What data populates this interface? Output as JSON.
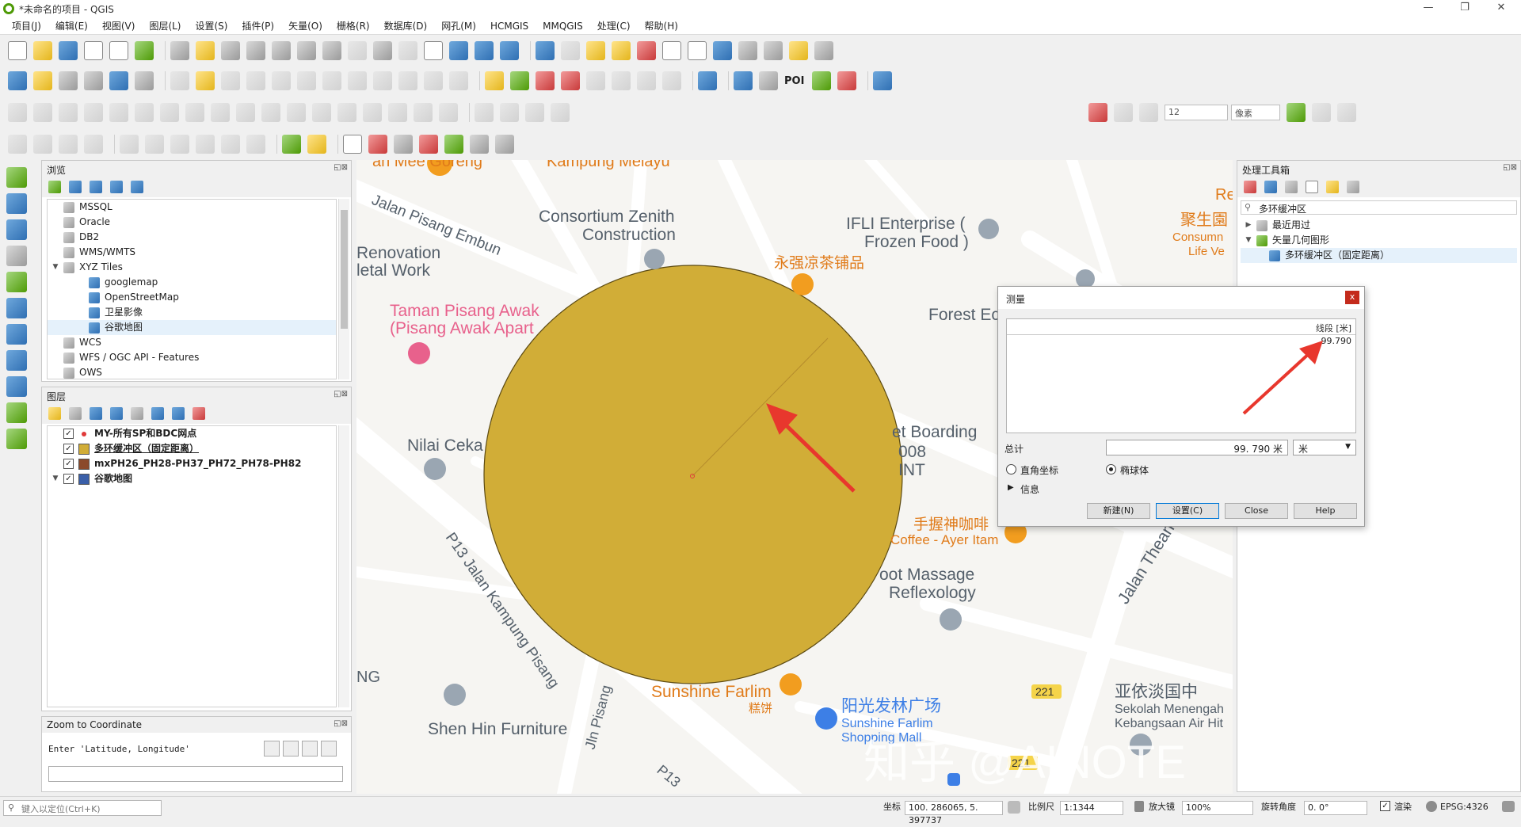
{
  "window": {
    "title": "*未命名的项目 - QGIS",
    "controls": [
      "—",
      "❐",
      "✕"
    ]
  },
  "menu": [
    "项目(J)",
    "编辑(E)",
    "视图(V)",
    "图层(L)",
    "设置(S)",
    "插件(P)",
    "矢量(O)",
    "栅格(R)",
    "数据库(D)",
    "网孔(M)",
    "HCMGIS",
    "MMQGIS",
    "处理(C)",
    "帮助(H)"
  ],
  "toolbar": {
    "poi_label": "POI",
    "snap_tolerance": "12",
    "snap_unit": "像素"
  },
  "browser": {
    "title": "浏览",
    "items": [
      {
        "label": "MSSQL",
        "indent": 1
      },
      {
        "label": "Oracle",
        "indent": 1
      },
      {
        "label": "DB2",
        "indent": 1
      },
      {
        "label": "WMS/WMTS",
        "indent": 1
      },
      {
        "label": "XYZ Tiles",
        "indent": 1
      },
      {
        "label": "googlemap",
        "indent": 2
      },
      {
        "label": "OpenStreetMap",
        "indent": 2
      },
      {
        "label": "卫星影像",
        "indent": 2
      },
      {
        "label": "谷歌地图",
        "indent": 2
      },
      {
        "label": "WCS",
        "indent": 1
      },
      {
        "label": "WFS / OGC API - Features",
        "indent": 1
      },
      {
        "label": "OWS",
        "indent": 1
      }
    ]
  },
  "layers": {
    "title": "图层",
    "items": [
      {
        "label": "MY-所有SP和BDC网点",
        "color": "#e03a3a"
      },
      {
        "label": "多环缓冲区（固定距离）",
        "color": "#d1ad37"
      },
      {
        "label": "mxPH26_PH28-PH37_PH72_PH78-PH82",
        "color": "#8b4a2b"
      },
      {
        "label": "谷歌地图",
        "color": "#3a5fa8"
      }
    ]
  },
  "zoom_coord": {
    "title": "Zoom to Coordinate",
    "prompt": "Enter 'Latitude, Longitude'",
    "value": ""
  },
  "toolbox": {
    "title": "处理工具箱",
    "search": "多环缓冲区",
    "items": [
      {
        "label": "最近用过"
      },
      {
        "label": "矢量几何图形"
      },
      {
        "label": "多环缓冲区（固定距离）"
      }
    ]
  },
  "map_labels": {
    "jalan_pisang_embun": "Jalan Pisang Embun",
    "consortium": "Consortium Zenith",
    "construction": "Construction",
    "ifli1": "IFLI Enterprise (",
    "ifli2": "Frozen Food )",
    "yongqiang": "永强凉茶铺品",
    "renovation": "Renovation",
    "metal_work": "letal Work",
    "taman1": "Taman Pisang Awak",
    "taman2": "(Pisang Awak Apart",
    "forest": "Forest Ec",
    "nilai": "Nilai Ceka",
    "boarding": "et Boarding",
    "b008": "008",
    "bint": "INT",
    "coffee_cn": "手握神咖啡",
    "coffee_en": "Coffee - Ayer Itam",
    "jalan_thean": "Jalan Thean",
    "massage1": "oot Massage",
    "massage2": "Reflexology",
    "p13_kampung": "P13 Jalan Kampung Pisang",
    "sunshine_farlim": "Sunshine Farlim",
    "gaobing": "糕饼",
    "mall_cn": "阳光发林广场",
    "mall_en1": "Sunshine Farlim",
    "mall_en2": "Shopping Mall",
    "school_cn": "亚依淡国中",
    "school_en1": "Sekolah Menengah",
    "school_en2": "Kebangsaan Air Hit",
    "shen_hin": "Shen Hin Furniture",
    "jln_pisang": "Jln Pisang",
    "p13": "P13",
    "ng": "NG",
    "re": "Re",
    "jusheng_cn": "聚生園",
    "jusheng_en1": "Consumn",
    "jusheng_en2": "Life Ve",
    "top_left": "an Mee Goreng",
    "top_mid": "Kampung Melayu",
    "route221": "221",
    "watermark": "知乎 @AINOTE"
  },
  "measure": {
    "title": "测量",
    "col_header": "线段 [米]",
    "segment_value": "99.790",
    "total_label": "总计",
    "total_value": "99. 790  米",
    "unit": "米",
    "cartesian_label": "直角坐标",
    "ellipsoidal_label": "椭球体",
    "info_label": "信息",
    "btn_new": "新建(N)",
    "btn_settings": "设置(C)",
    "btn_close": "Close",
    "btn_help": "Help"
  },
  "status": {
    "locator_placeholder": "键入以定位(Ctrl+K)",
    "coord_label": "坐标",
    "coord_value": "100. 286065, 5. 397737",
    "scale_label": "比例尺",
    "scale_value": "1:1344",
    "magnifier_label": "放大镜",
    "magnifier_value": "100%",
    "rotation_label": "旋转角度",
    "rotation_value": "0. 0°",
    "render_label": "渲染",
    "crs": "EPSG:4326"
  },
  "colors": {
    "buffer_fill": "#d1ad37",
    "arrow": "#e8372d",
    "map_bg": "#f6f5f2"
  }
}
